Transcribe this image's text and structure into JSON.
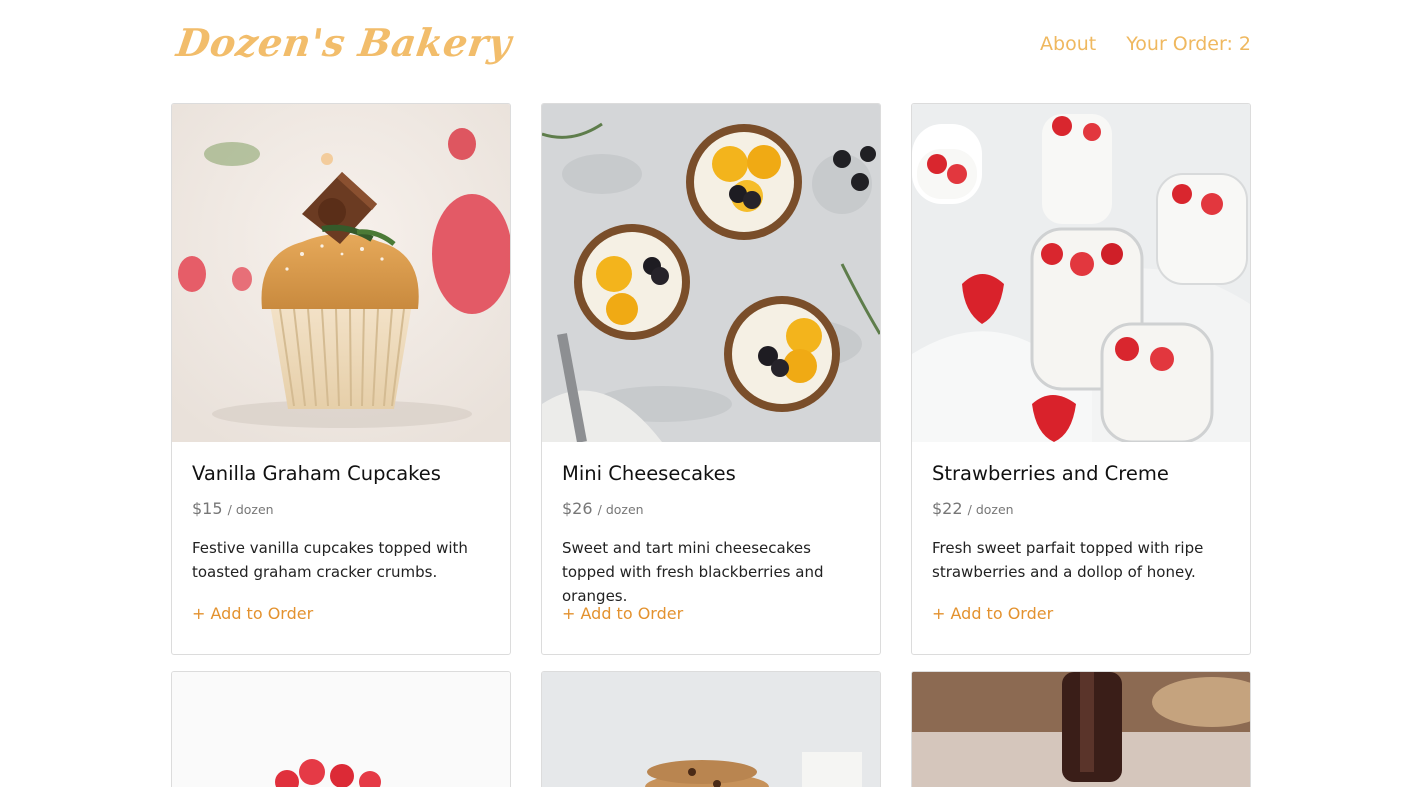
{
  "colors": {
    "brand": "#f2bd6b",
    "nav": "#efb85f",
    "accent": "#e3922f"
  },
  "header": {
    "logo": "Dozen's Bakery",
    "nav": {
      "about": "About",
      "order_label": "Your Order: 2"
    }
  },
  "products": [
    {
      "name": "Vanilla Graham Cupcakes",
      "price": "$15",
      "unit": "/ dozen",
      "description": "Festive vanilla cupcakes topped with toasted graham cracker crumbs.",
      "cta": "+ Add to Order"
    },
    {
      "name": "Mini Cheesecakes",
      "price": "$26",
      "unit": "/ dozen",
      "description": "Sweet and tart mini cheesecakes topped with fresh blackberries and oranges.",
      "cta": "+ Add to Order"
    },
    {
      "name": "Strawberries and Creme",
      "price": "$22",
      "unit": "/ dozen",
      "description": "Fresh sweet parfait topped with ripe strawberries and a dollop of honey.",
      "cta": "+ Add to Order"
    }
  ]
}
